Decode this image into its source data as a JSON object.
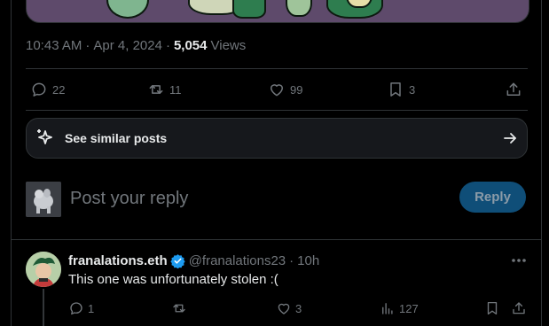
{
  "post": {
    "time": "10:43 AM",
    "date": "Apr 4, 2024",
    "views_count": "5,054",
    "views_label": "Views",
    "separator": "·"
  },
  "actions": {
    "replies": "22",
    "reposts": "11",
    "likes": "99",
    "bookmarks": "3"
  },
  "similar": {
    "label": "See similar posts"
  },
  "compose": {
    "placeholder": "Post your reply",
    "reply_button": "Reply"
  },
  "reply": {
    "display_name": "franalations.eth",
    "handle": "@franalations23",
    "separator": "·",
    "time": "10h",
    "text": "This one was unfortunately stolen :(",
    "replies": "1",
    "reposts": "",
    "likes": "3",
    "views": "127"
  },
  "colors": {
    "background": "#000000",
    "border": "#2f3336",
    "muted_text": "#71767b",
    "text": "#e7e9ea",
    "reply_button_bg": "#0f4e78",
    "verified_badge": "#1d9bf0"
  },
  "icons": [
    "reply-icon",
    "repost-icon",
    "like-icon",
    "bookmark-icon",
    "share-icon",
    "sparkle-icon",
    "arrow-right-icon",
    "verified-icon",
    "more-icon",
    "views-icon"
  ]
}
